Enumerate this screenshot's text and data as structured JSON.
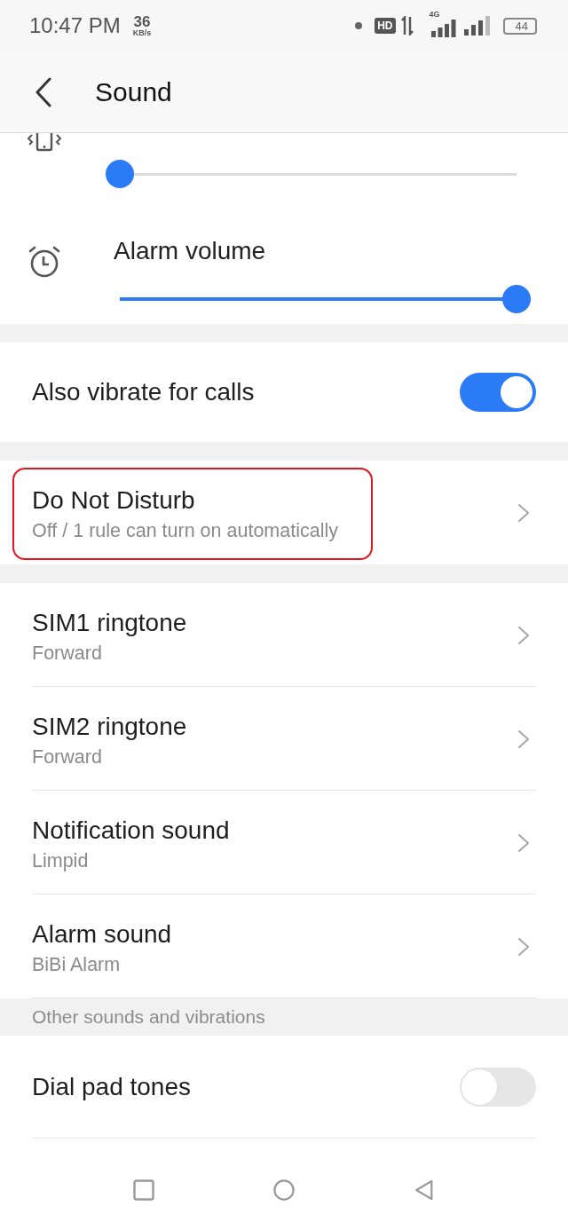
{
  "status_bar": {
    "time": "10:47 PM",
    "net_speed": "36",
    "net_speed_unit": "KB/s",
    "hd_badge": "HD",
    "network_type": "4G",
    "battery": "44"
  },
  "header": {
    "title": "Sound"
  },
  "volume_sliders": [
    {
      "level": 0
    },
    {
      "label": "Alarm volume",
      "level": 1
    }
  ],
  "vibrate_for_calls": {
    "label": "Also vibrate for calls",
    "on": true
  },
  "do_not_disturb": {
    "title": "Do Not Disturb",
    "subtitle": "Off / 1 rule can turn on automatically",
    "highlighted": true
  },
  "ringtones": [
    {
      "title": "SIM1 ringtone",
      "value": "Forward"
    },
    {
      "title": "SIM2 ringtone",
      "value": "Forward"
    },
    {
      "title": "Notification sound",
      "value": "Limpid"
    },
    {
      "title": "Alarm sound",
      "value": "BiBi Alarm"
    }
  ],
  "other_section": {
    "header": "Other sounds and vibrations",
    "items": [
      {
        "label": "Dial pad tones",
        "on": false
      }
    ]
  }
}
